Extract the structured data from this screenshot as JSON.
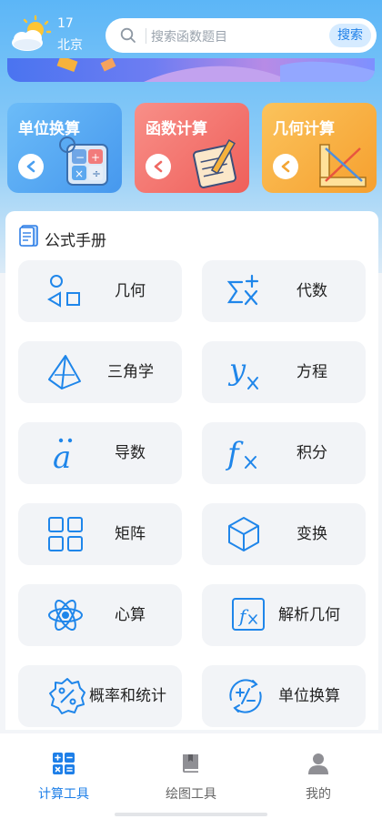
{
  "header": {
    "weather_icon": "partly-cloudy-icon",
    "temperature": "17",
    "city": "北京",
    "search": {
      "placeholder": "搜索函数题目",
      "button_label": "搜索"
    }
  },
  "tools": [
    {
      "title": "单位换算",
      "color": "#58aef6",
      "icon": "calculator-illustration"
    },
    {
      "title": "函数计算",
      "color": "#f3736b",
      "icon": "notebook-illustration"
    },
    {
      "title": "几何计算",
      "color": "#f9b442",
      "icon": "ruler-illustration"
    }
  ],
  "formula": {
    "title": "公式手册",
    "items": [
      {
        "label": "几何",
        "icon": "geometry-shapes-icon"
      },
      {
        "label": "代数",
        "icon": "sigma-x-icon"
      },
      {
        "label": "三角学",
        "icon": "pyramid-icon"
      },
      {
        "label": "方程",
        "icon": "y-x-icon"
      },
      {
        "label": "导数",
        "icon": "a-double-dot-icon"
      },
      {
        "label": "积分",
        "icon": "f-x-icon"
      },
      {
        "label": "矩阵",
        "icon": "grid-icon"
      },
      {
        "label": "变换",
        "icon": "cube-icon"
      },
      {
        "label": "心算",
        "icon": "atom-icon"
      },
      {
        "label": "解析几何",
        "icon": "f-x-box-icon"
      },
      {
        "label": "概率和统计",
        "icon": "percent-gear-icon"
      },
      {
        "label": "单位换算",
        "icon": "conversion-icon"
      }
    ]
  },
  "nav": [
    {
      "label": "计算工具",
      "active": true,
      "icon": "calculator-icon"
    },
    {
      "label": "绘图工具",
      "active": false,
      "icon": "book-icon"
    },
    {
      "label": "我的",
      "active": false,
      "icon": "person-icon"
    }
  ],
  "colors": {
    "accent": "#1e7fe8",
    "icon_blue": "#1f86ea",
    "tile_bg": "#f2f4f7"
  }
}
